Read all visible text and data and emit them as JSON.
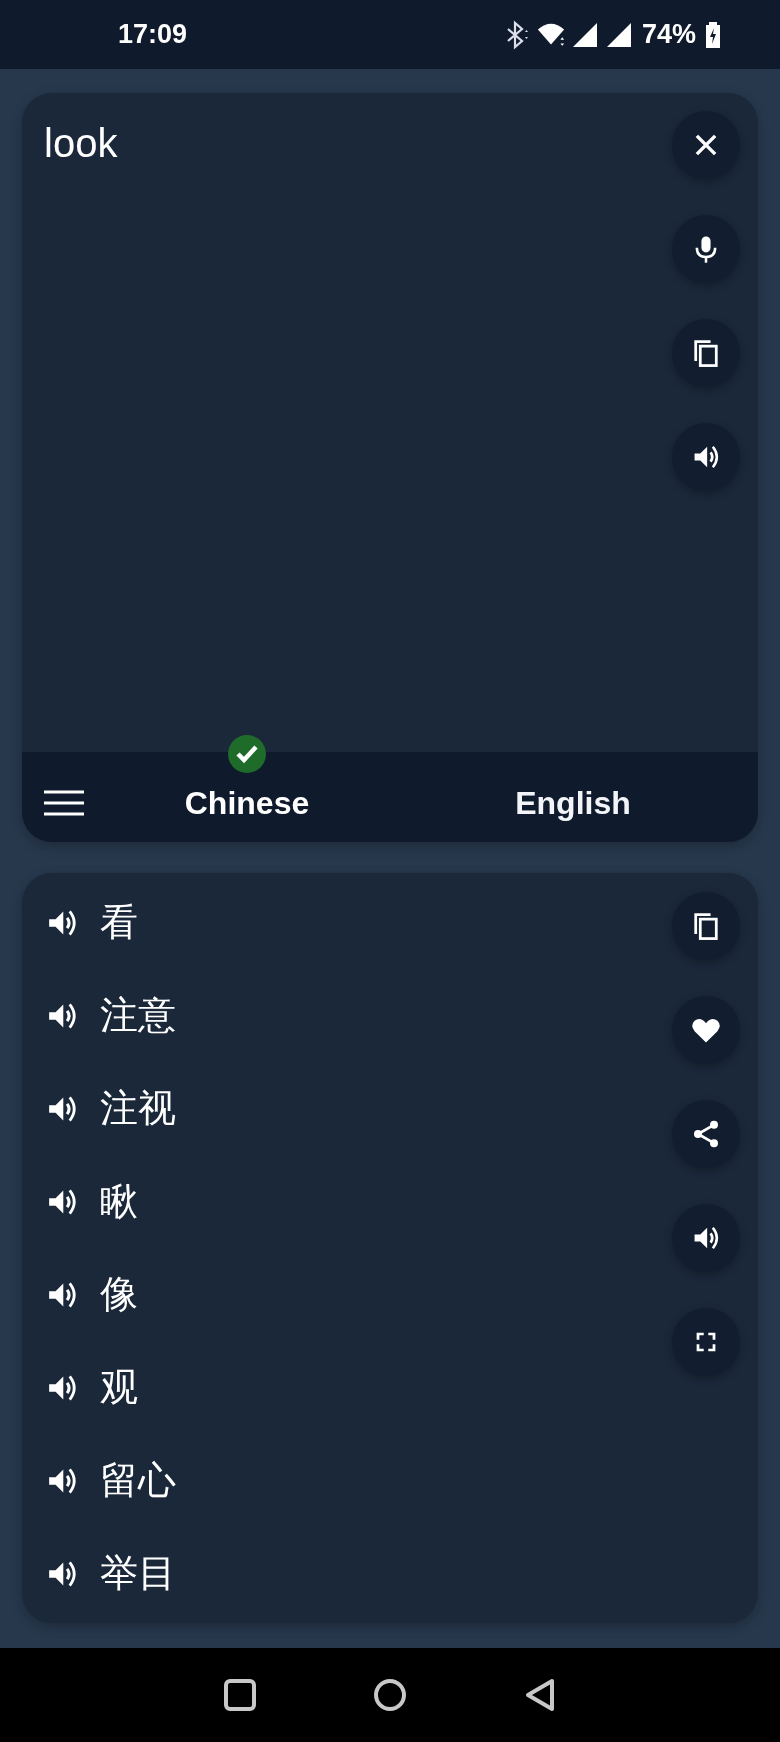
{
  "status_bar": {
    "time": "17:09",
    "battery_percent": "74%"
  },
  "input": {
    "value": "look"
  },
  "input_actions": [
    {
      "kind": "clear"
    },
    {
      "kind": "mic"
    },
    {
      "kind": "copy"
    },
    {
      "kind": "speak"
    }
  ],
  "languages": [
    {
      "label": "Chinese",
      "selected": true
    },
    {
      "label": "English",
      "selected": false
    }
  ],
  "translations": [
    "看",
    "注意",
    "注视",
    "瞅",
    "像",
    "观",
    "留心",
    "举目"
  ],
  "result_actions": [
    {
      "kind": "copy"
    },
    {
      "kind": "favorite"
    },
    {
      "kind": "share"
    },
    {
      "kind": "speak"
    },
    {
      "kind": "fullscreen"
    }
  ]
}
